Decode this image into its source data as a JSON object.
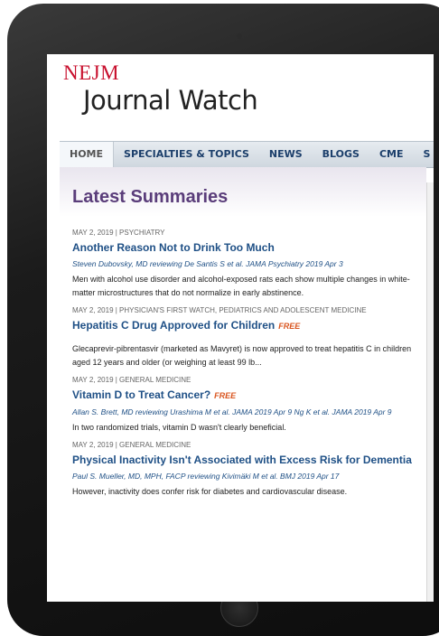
{
  "brand": {
    "nejm": "NEJM",
    "title": "Journal Watch"
  },
  "nav": {
    "items": [
      {
        "label": "HOME",
        "active": true
      },
      {
        "label": "SPECIALTIES & TOPICS",
        "active": false
      },
      {
        "label": "NEWS",
        "active": false
      },
      {
        "label": "BLOGS",
        "active": false
      },
      {
        "label": "CME",
        "active": false
      },
      {
        "label": "S",
        "active": false
      }
    ]
  },
  "section": {
    "title": "Latest Summaries"
  },
  "articles": [
    {
      "meta": "MAY 2, 2019 | PSYCHIATRY",
      "headline": "Another Reason Not to Drink Too Much",
      "free": "",
      "byline": "Steven Dubovsky, MD reviewing De Santis S et al. JAMA Psychiatry 2019 Apr 3",
      "summary": "Men with alcohol use disorder and alcohol-exposed rats each show multiple changes in white-matter microstructures that do not normalize in early abstinence."
    },
    {
      "meta": "MAY 2, 2019 | PHYSICIAN'S FIRST WATCH, PEDIATRICS AND ADOLESCENT MEDICINE",
      "headline": "Hepatitis C Drug Approved for Children",
      "free": "FREE",
      "byline": "",
      "summary": "Glecaprevir-pibrentasvir (marketed as Mavyret) is now approved to treat hepatitis C in children aged 12 years and older (or weighing at least 99 lb..."
    },
    {
      "meta": "MAY 2, 2019 | GENERAL MEDICINE",
      "headline": "Vitamin D to Treat Cancer?",
      "free": "FREE",
      "byline": "Allan S. Brett, MD reviewing Urashima M et al. JAMA 2019 Apr 9 Ng K et al. JAMA 2019 Apr 9",
      "summary": "In two randomized trials, vitamin D wasn't clearly beneficial."
    },
    {
      "meta": "MAY 2, 2019 | GENERAL MEDICINE",
      "headline": "Physical Inactivity Isn't Associated with Excess Risk for Dementia",
      "free": "",
      "byline": "Paul S. Mueller, MD, MPH, FACP reviewing Kivimäki M et al. BMJ 2019 Apr 17",
      "summary": "However, inactivity does confer risk for diabetes and cardiovascular disease."
    }
  ],
  "colors": {
    "brand_red": "#c8102e",
    "headline_blue": "#1f5086",
    "section_purple": "#5a3d7a",
    "free_orange": "#d9541e"
  }
}
